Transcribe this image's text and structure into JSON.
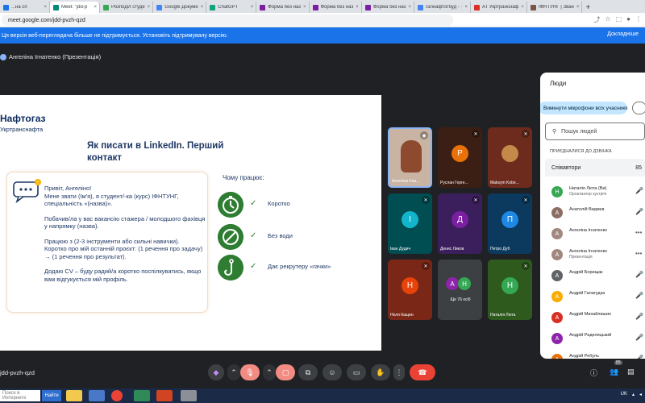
{
  "browser": {
    "tabs": [
      {
        "title": "...на сп",
        "color": "#1a73e8",
        "active": false
      },
      {
        "title": "Meet: \"jdd-p",
        "color": "#00897b",
        "active": true
      },
      {
        "title": "Розподіл студе",
        "color": "#34a853",
        "active": false
      },
      {
        "title": "Google Докуме",
        "color": "#4285f4",
        "active": false
      },
      {
        "title": "ChatGPT",
        "color": "#10a37f",
        "active": false
      },
      {
        "title": "Форма без наз",
        "color": "#7b1fa2",
        "active": false
      },
      {
        "title": "Форма без наз",
        "color": "#7b1fa2",
        "active": false
      },
      {
        "title": "Форма без наз",
        "color": "#7b1fa2",
        "active": false
      },
      {
        "title": "галнафтогбуд - Т",
        "color": "#4285f4",
        "active": false
      },
      {
        "title": "АТ Укртранснаф",
        "color": "#d93025",
        "active": false
      },
      {
        "title": "ІФНТУНГ | Зван",
        "color": "#795548",
        "active": false
      }
    ],
    "url": "meet.google.com/jdd-pvzh-qzd",
    "infobar_text": "Ця версія веб-переглядача більше не підтримується. Установіть підтримувану версію.",
    "infobar_link": "Докладніше"
  },
  "meet": {
    "presenter_label": "Ангеліна Ігнатенко (Презентація)",
    "meeting_code": "jdd-pvzh-qzd"
  },
  "slide": {
    "logo_main": "Нафтогаз",
    "logo_sub": "Укртранснафта",
    "title": "Як писати в LinkedIn. Перший контакт",
    "message": [
      "Привіт, Ангеліно!\nМене звати (Ім'я), я студент/-ка (курс) ІФНТУНГ, спеціальність «(назва)».",
      "Побачив/ла у вас вакансію стажера / молодшого фахівця у напрямку (назва).",
      "Працюю з (2-3 інструменти або сильні навички).\nКоротко про мій останній проєкт: (1 речення про задачу) → (1 речення про результат).",
      "Додаю CV – буду радий/а коротко поспілкуватись, якщо вам відгукується мій профіль."
    ],
    "why_title": "Чому працює:",
    "why_items": [
      "Коротко",
      "Без води",
      "Дає рекрутеру «гачки»"
    ],
    "check_glyph": "✓"
  },
  "tiles": [
    {
      "name": "Ангеліна Ігна...",
      "initial": "",
      "bg": "#c9b4a4",
      "avatar": "",
      "video": true
    },
    {
      "name": "Руслан Герге...",
      "initial": "Р",
      "bg": "#3c1f14",
      "avatar": "#e8710a",
      "video": false
    },
    {
      "name": "Maksym Kobe...",
      "initial": "",
      "bg": "#6d2b1e",
      "avatar": "#c58a4a",
      "video": false
    },
    {
      "name": "Іван Дудич",
      "initial": "І",
      "bg": "#004d52",
      "avatar": "#12b5cb",
      "video": false
    },
    {
      "name": "Денис Ликов",
      "initial": "Д",
      "bg": "#3b1f5c",
      "avatar": "#7b1fa2",
      "video": false
    },
    {
      "name": "Петро Дуб",
      "initial": "П",
      "bg": "#0b3a5e",
      "avatar": "#1e88e5",
      "video": false
    },
    {
      "name": "Неля Кащин",
      "initial": "Н",
      "bg": "#7a2717",
      "avatar": "#e8430a",
      "video": false
    },
    {
      "name": "Ще 76 осіб",
      "initial": "",
      "bg": "#3c4043",
      "avatar": "",
      "video": false
    },
    {
      "name": "Наталія Люта",
      "initial": "Н",
      "bg": "#2f5a1e",
      "avatar": "#34a853",
      "video": false
    }
  ],
  "more_avatars": [
    "А",
    "Н"
  ],
  "people_panel": {
    "title": "Люди",
    "mute_all": "Вимкнути мікрофони всіх учасників",
    "search_placeholder": "Пошук людей",
    "in_call_label": "ПРИЄДНАЛИСЯ ДО ДЗВІНКА",
    "collaborators_label": "Співавтори",
    "collaborators_count": "85",
    "people": [
      {
        "name": "Наталія Люта (Ви)",
        "sub": "Організатор зустрічі",
        "initial": "Н",
        "color": "#34a853",
        "mic": "🎤"
      },
      {
        "name": "Анатолій Ведмєв",
        "sub": "",
        "initial": "А",
        "color": "#8d6e63",
        "mic": "🎤"
      },
      {
        "name": "Ангеліна Ігнатенко",
        "sub": "",
        "initial": "А",
        "color": "#a1887f",
        "mic": "•••"
      },
      {
        "name": "Ангеліна Ігнатенко",
        "sub": "Презентація",
        "initial": "А",
        "color": "#a1887f",
        "mic": "•••"
      },
      {
        "name": "Андрій Борищак",
        "sub": "",
        "initial": "А",
        "color": "#5f6368",
        "mic": "🎤"
      },
      {
        "name": "Андрій Галагудза",
        "sub": "",
        "initial": "А",
        "color": "#f9ab00",
        "mic": "🎤"
      },
      {
        "name": "Андрій Михайлишин",
        "sub": "",
        "initial": "А",
        "color": "#d93025",
        "mic": "🎤"
      },
      {
        "name": "Андрій Раделицький",
        "sub": "",
        "initial": "А",
        "color": "#8e24aa",
        "mic": "🎤"
      },
      {
        "name": "Андрій Ребуль",
        "sub": "",
        "initial": "А",
        "color": "#e8710a",
        "mic": "🎤"
      }
    ]
  },
  "controls": {
    "participants_badge": "85"
  },
  "taskbar": {
    "search_text": "Поиск в Интернете",
    "search_button": "Найти",
    "tray_text": "UK"
  },
  "colors": {
    "accent": "#1a73e8",
    "end_call": "#ea4335",
    "slide_green": "#2e7d32"
  }
}
